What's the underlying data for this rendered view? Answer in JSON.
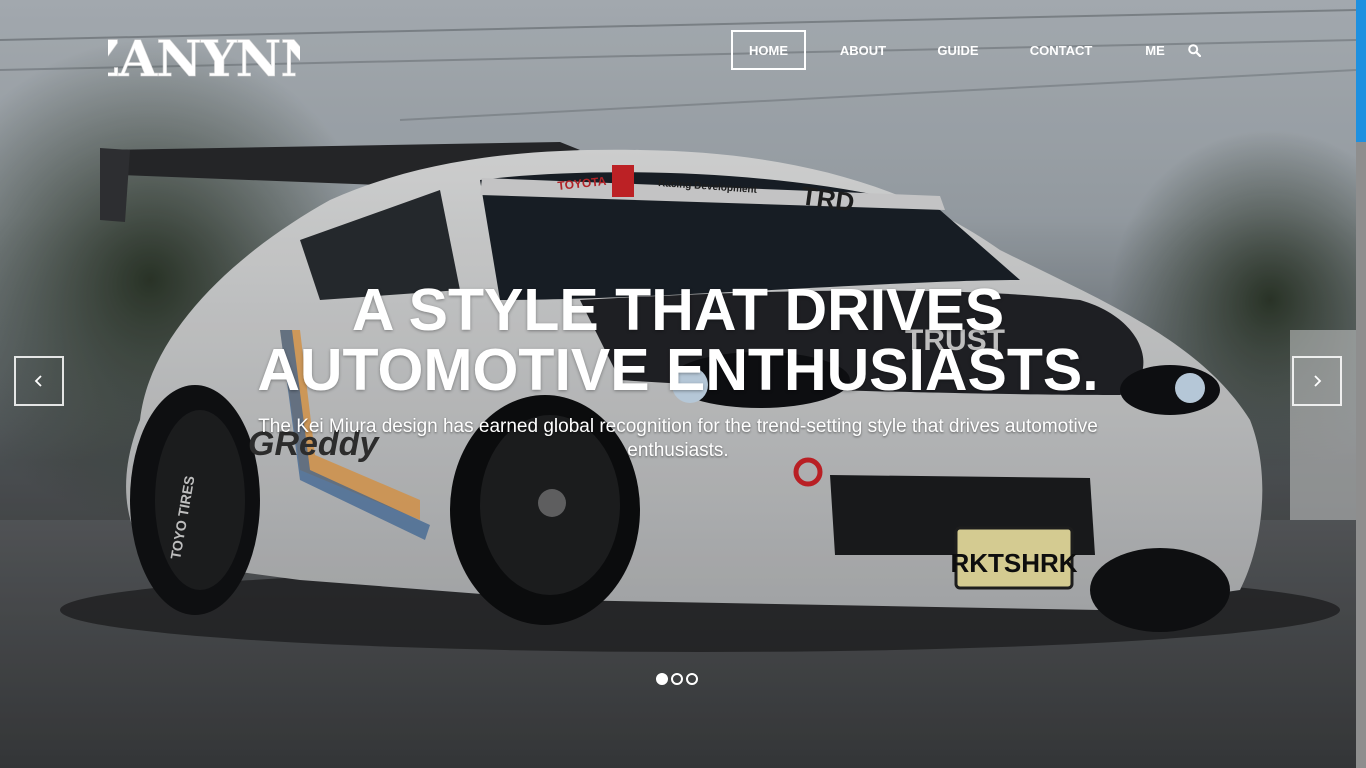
{
  "brand": {
    "logo_text": "ZANYNN"
  },
  "nav": {
    "items": [
      {
        "label": "HOME",
        "active": true
      },
      {
        "label": "ABOUT",
        "active": false
      },
      {
        "label": "GUIDE",
        "active": false
      },
      {
        "label": "CONTACT",
        "active": false
      },
      {
        "label": "ME",
        "active": false
      }
    ],
    "search_icon": "search-icon"
  },
  "slide": {
    "headline_line1": "A STYLE THAT DRIVES",
    "headline_line2": "AUTOMOTIVE ENTHUSIASTS.",
    "subtext": "The Kei Miura design has earned global recognition for the trend-setting style that drives automotive enthusiasts.",
    "car_texts": {
      "windshield_brand": "TOYOTA",
      "windshield_banner": "Racing Development",
      "windshield_trd": "TRD",
      "plate": "RKTSHRK",
      "tire_left": "TOYO TIRES",
      "side_logo": "GReddy",
      "hood_logo": "TRUST"
    }
  },
  "carousel": {
    "slide_count": 3,
    "active_index": 0,
    "prev_icon": "chevron-left-icon",
    "next_icon": "chevron-right-icon"
  },
  "colors": {
    "accent_scroll": "#1e90e0",
    "text": "#ffffff"
  }
}
